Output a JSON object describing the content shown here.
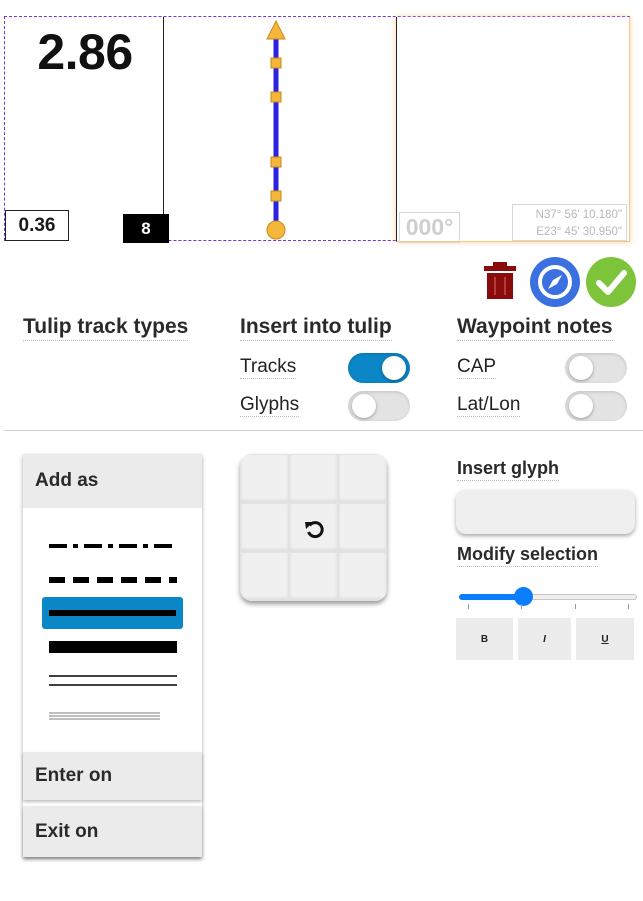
{
  "roadbook_row": {
    "total_distance": "2.86",
    "partial_distance": "0.36",
    "row_number": "8",
    "heading": "000°",
    "coordinates": {
      "lat": "N37° 56' 10.180\"",
      "lon": "E23° 45' 30.950\""
    }
  },
  "actions": {
    "delete": "trash-icon",
    "navigate": "compass-icon",
    "confirm": "check-icon"
  },
  "tulip_track_types": {
    "heading": "Tulip track types"
  },
  "insert_into_tulip": {
    "heading": "Insert into tulip",
    "options": [
      {
        "label": "Tracks",
        "on": true
      },
      {
        "label": "Glyphs",
        "on": false
      }
    ]
  },
  "waypoint_notes": {
    "heading": "Waypoint notes",
    "options": [
      {
        "label": "CAP",
        "on": false
      },
      {
        "label": "Lat/Lon",
        "on": false
      }
    ]
  },
  "track_panel": {
    "sections": {
      "add": "Add as",
      "enter": "Enter on",
      "exit": "Exit on"
    },
    "track_styles": [
      "dash-dot",
      "dashed",
      "thick",
      "heavy",
      "double",
      "triple-thin"
    ],
    "selected_style": "thick"
  },
  "rotate_grid": {
    "center_icon": "rotate-icon"
  },
  "glyphs": {
    "insert_heading": "Insert glyph",
    "modify_heading": "Modify selection",
    "size_slider_fraction": 0.36,
    "format_buttons": [
      "B",
      "I",
      "U"
    ]
  },
  "colors": {
    "accent_blue": "#0b86c6",
    "tulip_line": "#2b22e0",
    "tulip_marker": "#f5b73b",
    "trash": "#8a0b0b",
    "navigate": "#3b70e0",
    "confirm": "#7ec43b",
    "row_border": "#7a2fe0"
  }
}
